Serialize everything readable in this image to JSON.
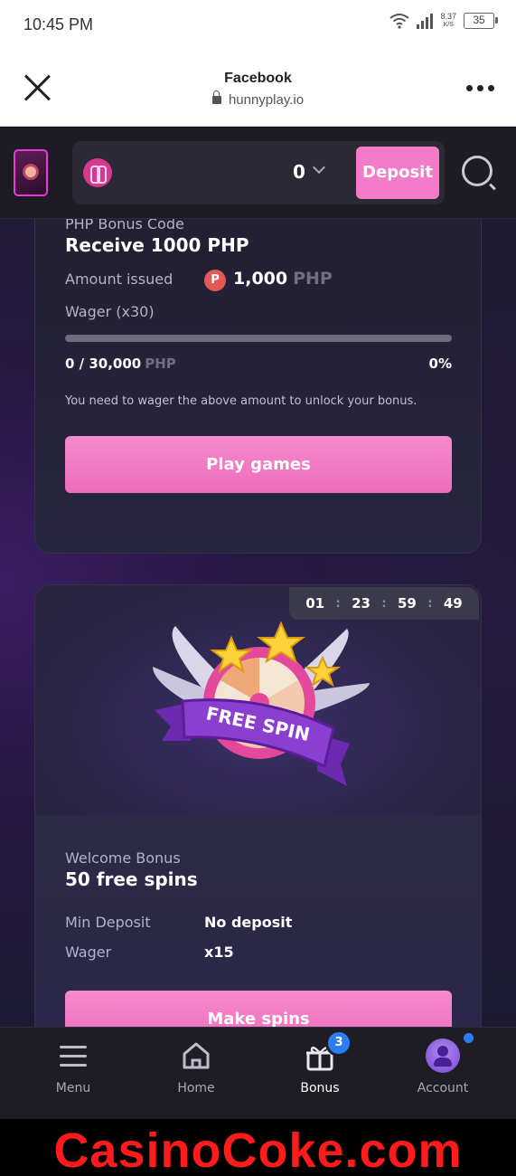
{
  "status_bar": {
    "time": "10:45 PM",
    "speed_value": "8.37",
    "speed_unit": "K/S",
    "battery": "35"
  },
  "browser": {
    "title": "Facebook",
    "url": "hunnyplay.io"
  },
  "header": {
    "balance": "0",
    "deposit_label": "Deposit"
  },
  "bonus_code_card": {
    "label": "PHP Bonus Code",
    "title": "Receive 1000 PHP",
    "amount_label": "Amount issued",
    "amount_icon_letter": "P",
    "amount_value": "1,000",
    "currency": "PHP",
    "wager_label": "Wager (x30)",
    "progress_fraction": 0,
    "progress_text": "0 / 30,000",
    "progress_currency": "PHP",
    "progress_percent": "0%",
    "note": "You need to wager the above amount to unlock your bonus.",
    "button": "Play games"
  },
  "free_spin_card": {
    "timer": [
      "01",
      "23",
      "59",
      "49"
    ],
    "hero_text": "FREE SPIN",
    "label": "Welcome Bonus",
    "title": "50 free spins",
    "min_deposit_label": "Min Deposit",
    "min_deposit_value": "No deposit",
    "wager_label": "Wager",
    "wager_value": "x15",
    "button": "Make spins"
  },
  "bottom_nav": {
    "items": [
      {
        "label": "Menu",
        "icon": "menu-icon"
      },
      {
        "label": "Home",
        "icon": "home-icon"
      },
      {
        "label": "Bonus",
        "icon": "gift-icon",
        "badge": "3",
        "active": true
      },
      {
        "label": "Account",
        "icon": "avatar"
      }
    ]
  },
  "watermark": "CasinoCoke.com",
  "colors": {
    "accent_pink": "#f47bc7",
    "badge_blue": "#2c7ef0",
    "background": "#1b1a2a"
  }
}
